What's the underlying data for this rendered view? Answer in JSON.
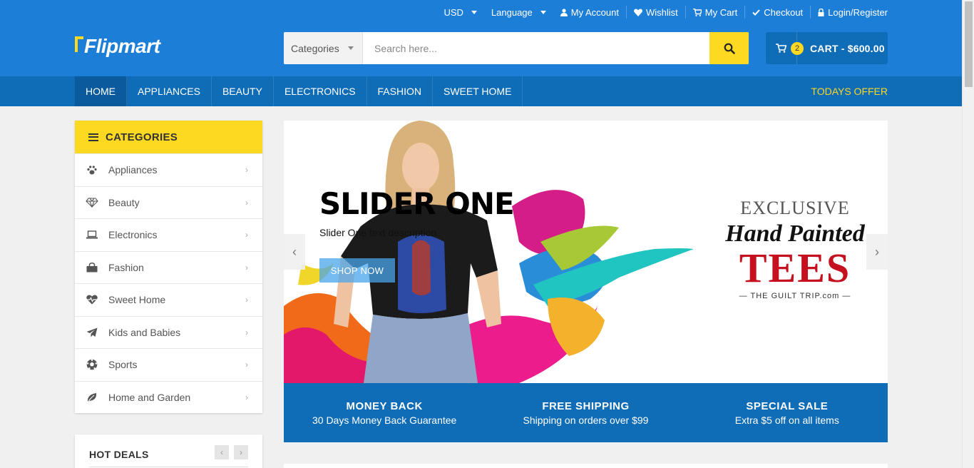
{
  "topbar": {
    "currency": "USD",
    "language": "Language",
    "links": [
      "My Account",
      "Wishlist",
      "My Cart",
      "Checkout",
      "Login/Register"
    ]
  },
  "brand": {
    "name": "Flipmart"
  },
  "search": {
    "category": "Categories",
    "placeholder": "Search here..."
  },
  "cart": {
    "count": "2",
    "label": "CART - $600.00"
  },
  "nav": {
    "items": [
      "HOME",
      "APPLIANCES",
      "BEAUTY",
      "ELECTRONICS",
      "FASHION",
      "SWEET HOME"
    ],
    "offer": "TODAYS OFFER"
  },
  "sidebar": {
    "title": "CATEGORIES",
    "items": [
      {
        "label": "Appliances",
        "icon": "paw-icon"
      },
      {
        "label": "Beauty",
        "icon": "diamond-icon"
      },
      {
        "label": "Electronics",
        "icon": "laptop-icon"
      },
      {
        "label": "Fashion",
        "icon": "shopping-bag-icon"
      },
      {
        "label": "Sweet Home",
        "icon": "heartbeat-icon"
      },
      {
        "label": "Kids and Babies",
        "icon": "paper-plane-icon"
      },
      {
        "label": "Sports",
        "icon": "soccer-ball-icon"
      },
      {
        "label": "Home and Garden",
        "icon": "leaf-icon"
      }
    ]
  },
  "hot_deals": {
    "title": "HOT DEALS"
  },
  "slider": {
    "title": "SLIDER ONE",
    "description": "Slider One text description",
    "button": "SHOP NOW",
    "banner": {
      "line1": "EXCLUSIVE",
      "line2": "Hand Painted",
      "line3": "TEES",
      "line4": "— THE GUILT TRIP.com —"
    }
  },
  "info": [
    {
      "title": "MONEY BACK",
      "subtitle": "30 Days Money Back Guarantee"
    },
    {
      "title": "FREE SHIPPING",
      "subtitle": "Shipping on orders over $99"
    },
    {
      "title": "SPECIAL SALE",
      "subtitle": "Extra $5 off on all items"
    }
  ],
  "colors": {
    "primary": "#1d7ed7",
    "secondary": "#0f6cb6",
    "accent": "#fdd922"
  }
}
